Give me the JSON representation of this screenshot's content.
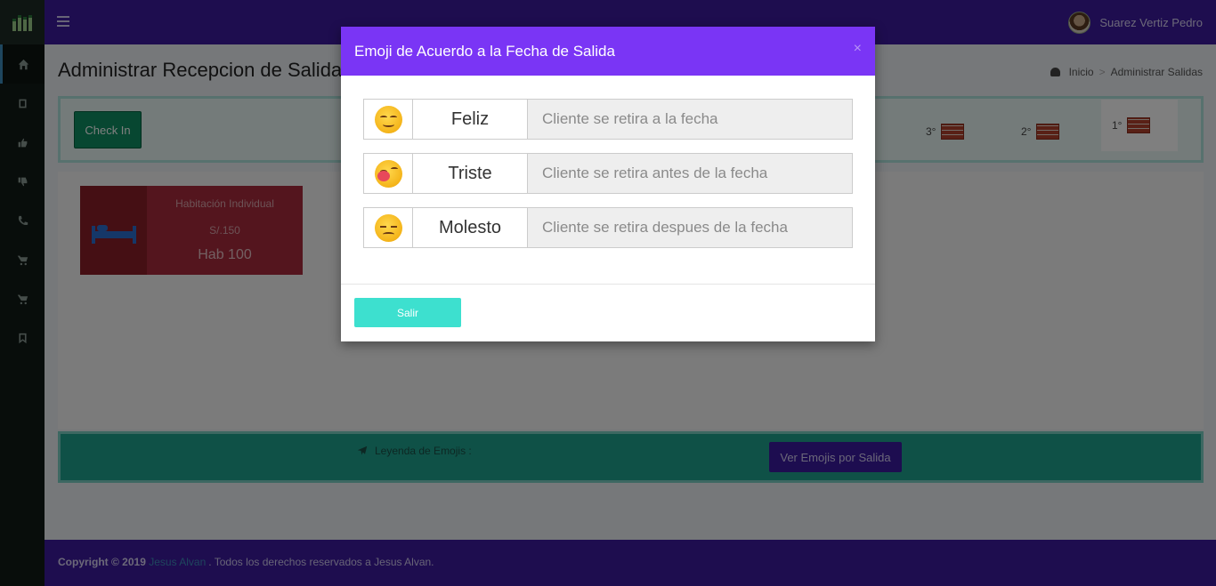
{
  "header": {
    "user_name": "Suarez Vertiz Pedro"
  },
  "sidebar": {
    "items": [
      {
        "icon": "home-icon"
      },
      {
        "icon": "book-icon"
      },
      {
        "icon": "thumbs-up-icon"
      },
      {
        "icon": "thumbs-down-icon"
      },
      {
        "icon": "phone-icon"
      },
      {
        "icon": "cart-icon"
      },
      {
        "icon": "cart-icon"
      },
      {
        "icon": "bookmark-icon"
      }
    ]
  },
  "page": {
    "title": "Administrar Recepcion de Salida",
    "breadcrumb": {
      "home": "Inicio",
      "current": "Administrar Salidas"
    }
  },
  "toolbar": {
    "checkin_label": "Check In",
    "floors": [
      {
        "label": "3°"
      },
      {
        "label": "2°"
      },
      {
        "label": "1°"
      }
    ]
  },
  "room": {
    "type": "Habitación Individual",
    "price": "S/.150",
    "number": "Hab 100"
  },
  "legend": {
    "label": "Leyenda de Emojis :",
    "button_label": "Ver Emojis por Salida"
  },
  "footer": {
    "copyright": "Copyright © 2019",
    "author_link": "Jesus Alvan",
    "rest": ". Todos los derechos reservados a Jesus Alvan."
  },
  "modal": {
    "title": "Emoji de Acuerdo a la Fecha de Salida",
    "close_symbol": "×",
    "rows": [
      {
        "emoji": "smiling-face-icon",
        "name": "Feliz",
        "placeholder": "Cliente se retira a la fecha"
      },
      {
        "emoji": "crying-face-icon",
        "name": "Triste",
        "placeholder": "Cliente se retira antes de la fecha"
      },
      {
        "emoji": "angry-face-icon",
        "name": "Molesto",
        "placeholder": "Cliente se retira despues de la fecha"
      }
    ],
    "exit_label": "Salir"
  },
  "colors": {
    "topbar": "#3d1a9e",
    "modal_header": "#7a35f5",
    "exit_button": "#3de0cf",
    "checkin_button": "#0f8f62",
    "legend_bar": "#1fa38f"
  }
}
